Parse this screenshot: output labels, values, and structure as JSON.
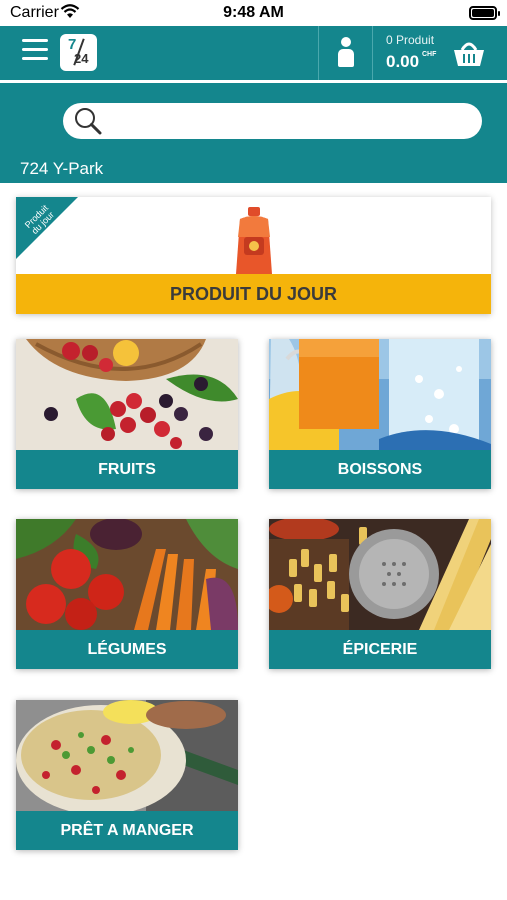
{
  "status_bar": {
    "carrier": "Carrier",
    "time": "9:48 AM"
  },
  "header": {
    "logo_text_top": "7",
    "logo_text_bottom": "24",
    "cart_count": "0 Produit",
    "cart_total": "0.00",
    "cart_currency": "CHF"
  },
  "search": {
    "placeholder": "",
    "value": ""
  },
  "location": "724 Y-Park",
  "product_of_day": {
    "ribbon_line1": "Produit",
    "ribbon_line2": "du jour",
    "label": "PRODUIT DU JOUR"
  },
  "categories": [
    {
      "label": "FRUITS"
    },
    {
      "label": "BOISSONS"
    },
    {
      "label": "LÉGUMES"
    },
    {
      "label": "ÉPICERIE"
    },
    {
      "label": "PRÊT A MANGER"
    }
  ],
  "colors": {
    "brand_teal": "#14868d",
    "accent_yellow": "#f5b40b"
  }
}
